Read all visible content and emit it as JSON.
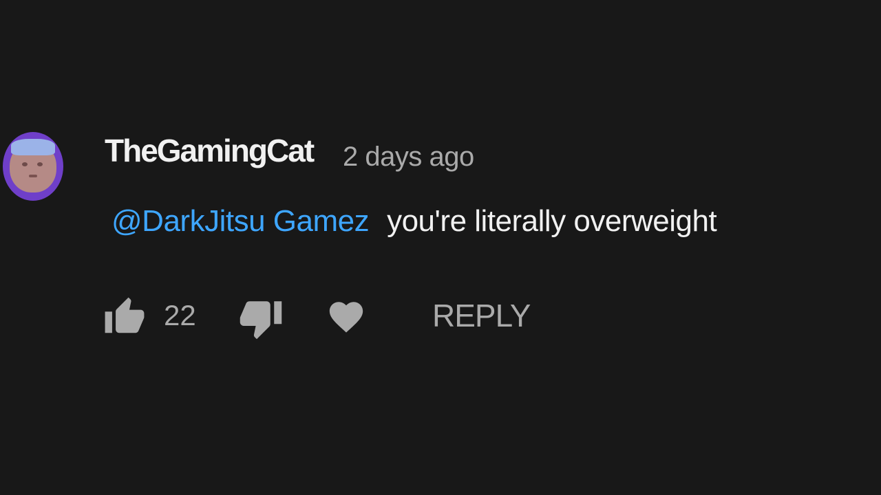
{
  "comment": {
    "author": "TheGamingCat",
    "timestamp": "2 days ago",
    "mention": "@DarkJitsu Gamez",
    "text": "you're literally overweight",
    "like_count": "22",
    "reply_label": "REPLY"
  },
  "icons": {
    "avatar": "avatar",
    "like": "thumbs-up-icon",
    "dislike": "thumbs-down-icon",
    "heart": "heart-icon"
  },
  "colors": {
    "background": "#181818",
    "author": "#f1f1f1",
    "timestamp": "#aaaaaa",
    "mention": "#3ea6ff",
    "comment_text": "#f1f1f1",
    "action": "#aaaaaa",
    "avatar_bg": "#6f3fc9"
  }
}
